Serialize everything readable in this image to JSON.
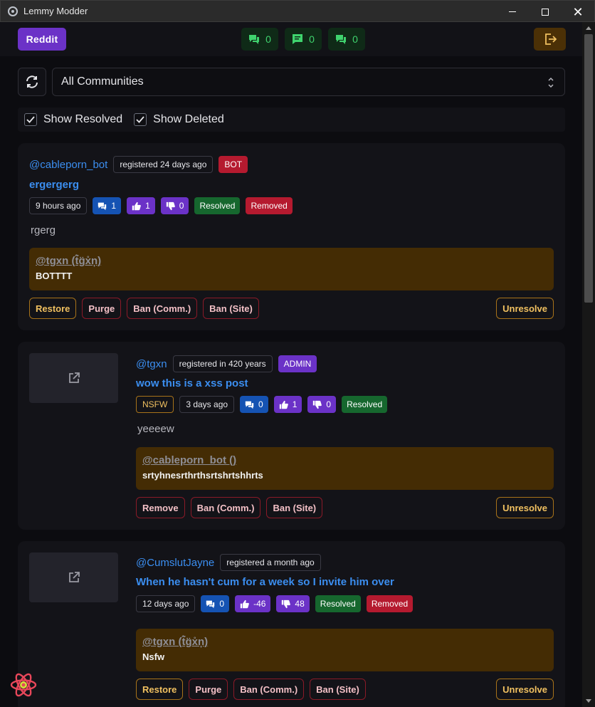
{
  "window": {
    "title": "Lemmy Modder"
  },
  "topbar": {
    "reddit_label": "Reddit",
    "counts": [
      {
        "icon": "comments-icon",
        "value": "0"
      },
      {
        "icon": "message-icon",
        "value": "0"
      },
      {
        "icon": "comments-icon",
        "value": "0"
      }
    ],
    "logout_icon": "logout-icon"
  },
  "controls": {
    "community_selected": "All Communities",
    "show_resolved_label": "Show Resolved",
    "show_deleted_label": "Show Deleted",
    "show_resolved_checked": true,
    "show_deleted_checked": true
  },
  "reports": [
    {
      "user": "@cableporn_bot",
      "registered": "registered 24 days ago",
      "role": "BOT",
      "title": "ergergerg",
      "age": "9 hours ago",
      "comments": "1",
      "upvotes": "1",
      "downvotes": "0",
      "status": [
        "Resolved",
        "Removed"
      ],
      "body": "rgerg",
      "reporter": "@tgxn (t̃̀g̈x̊n̦)",
      "reason": "BOTTTT",
      "actions": [
        "Restore",
        "Purge",
        "Ban (Comm.)",
        "Ban (Site)"
      ],
      "unresolve_label": "Unresolve"
    },
    {
      "user": "@tgxn",
      "registered": "registered in 420 years",
      "role": "ADMIN",
      "title": "wow this is a xss post",
      "nsfw": "NSFW",
      "age": "3 days ago",
      "comments": "0",
      "upvotes": "1",
      "downvotes": "0",
      "status": [
        "Resolved"
      ],
      "body": "yeeeew",
      "reporter": "@cableporn_bot ()",
      "reason": "srtyhnesrthrthsrtshrtshhrts",
      "actions": [
        "Remove",
        "Ban (Comm.)",
        "Ban (Site)"
      ],
      "unresolve_label": "Unresolve"
    },
    {
      "user": "@CumslutJayne",
      "registered": "registered a month ago",
      "title": "When he hasn't cum for a week so I invite him over",
      "age": "12 days ago",
      "comments": "0",
      "upvotes": "-46",
      "downvotes": "48",
      "status": [
        "Resolved",
        "Removed"
      ],
      "reporter": "@tgxn (t̃̀g̈x̊n̦)",
      "reason": "Nsfw",
      "actions": [
        "Restore",
        "Purge",
        "Ban (Comm.)",
        "Ban (Site)"
      ],
      "unresolve_label": "Unresolve"
    }
  ],
  "colors": {
    "accent_purple": "#6b32c7",
    "link_blue": "#3b8ef0",
    "success_green": "#16672e",
    "danger_red": "#b51a2f",
    "warning_amber": "#a8731a"
  }
}
